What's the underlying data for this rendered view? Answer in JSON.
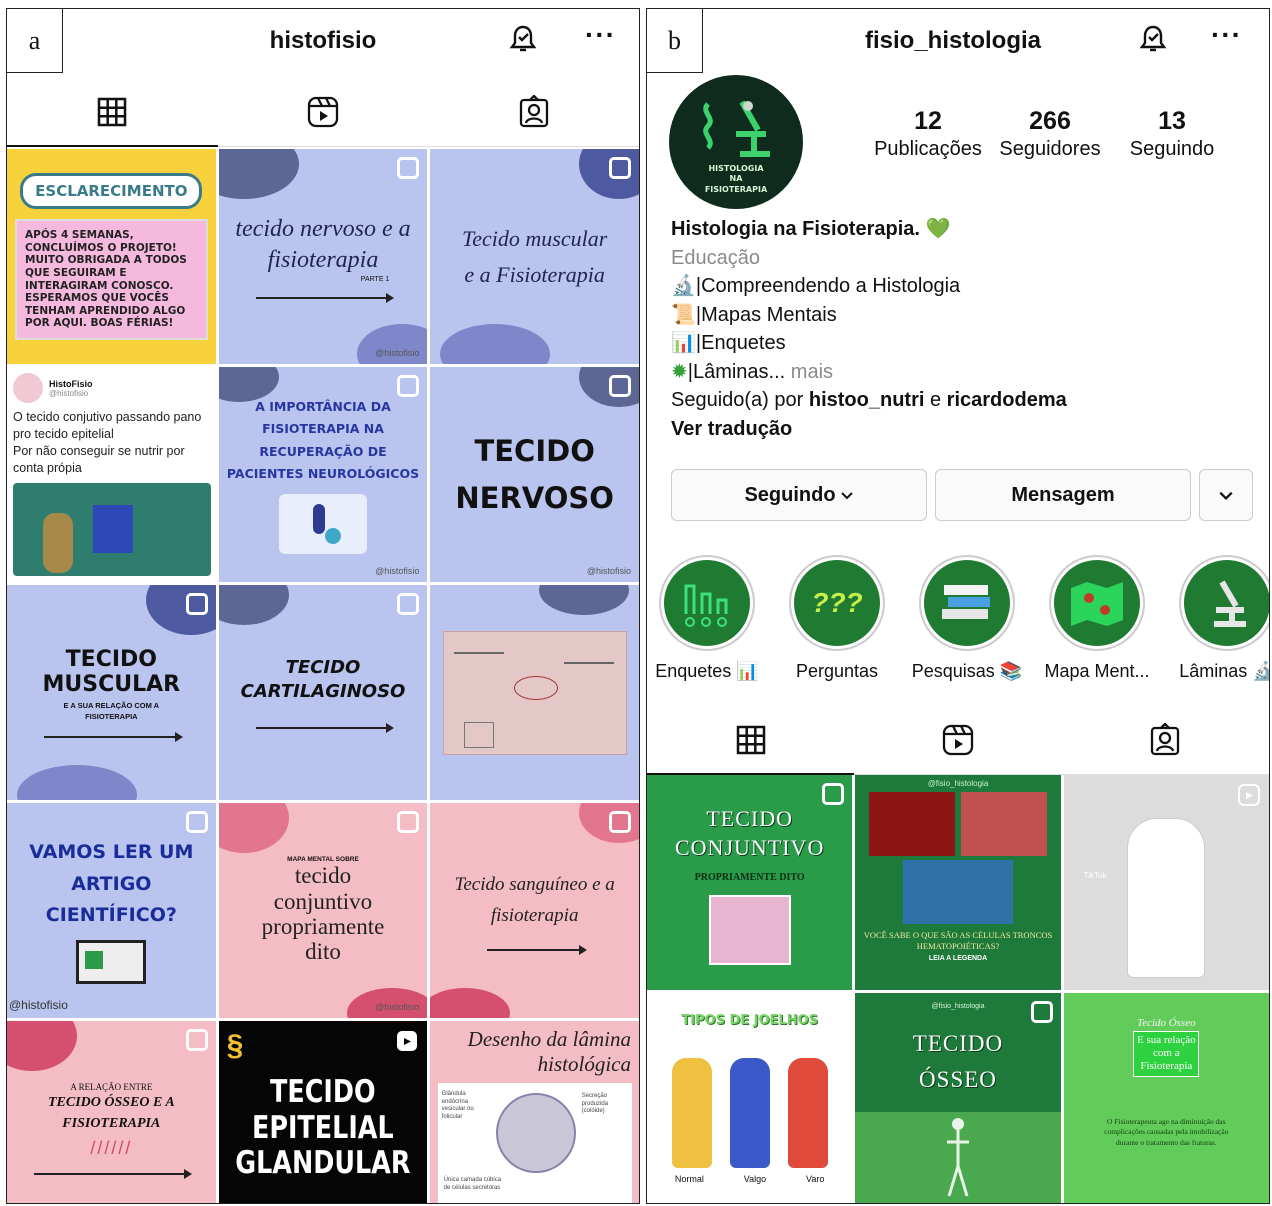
{
  "panel_a": {
    "letter": "a",
    "username": "histofisio",
    "more": "···",
    "icons": {
      "bell": "bell-check-icon",
      "grid": "grid-icon",
      "reels": "reels-icon",
      "tagged": "tagged-icon"
    },
    "posts": {
      "p1": {
        "title": "ESCLARECIMENTO",
        "body": "APÓS 4 SEMANAS, CONCLUÍMOS O PROJETO! MUITO OBRIGADA A TODOS QUE SEGUIRAM E INTERAGIRAM CONOSCO. ESPERAMOS QUE VOCÊS TENHAM APRENDIDO ALGO POR AQUI. BOAS FÉRIAS!"
      },
      "p2": {
        "title": "tecido nervoso e a fisioterapia",
        "small": "PARTE 1",
        "wm": "@histofisio"
      },
      "p3": {
        "title": "Tecido muscular e a Fisioterapia"
      },
      "p4": {
        "name": "HistoFisio",
        "handle": "@histofisio",
        "text": "O tecido conjutivo passando pano pro tecido epitelial\nPor não conseguir se nutrir por conta própia"
      },
      "p5": {
        "title": "A IMPORTÂNCIA DA FISIOTERAPIA NA RECUPERAÇÃO DE PACIENTES NEUROLÓGICOS",
        "wm": "@histofisio"
      },
      "p6": {
        "title": "TECIDO NERVOSO",
        "wm": "@histofisio"
      },
      "p7": {
        "title": "TECIDO MUSCULAR",
        "sub": "E A SUA RELAÇÃO COM A FISIOTERAPIA"
      },
      "p8": {
        "title": "TECIDO CARTILAGINOSO"
      },
      "p10": {
        "title": "VAMOS LER UM ARTIGO CIENTÍFICO?",
        "wm": "@histofisio"
      },
      "p11": {
        "title": "tecido conjuntivo propriamente dito",
        "small": "MAPA MENTAL SOBRE",
        "wm": "@histofisio"
      },
      "p12": {
        "title": "Tecido sanguíneo e a fisioterapia"
      },
      "p13": {
        "small": "A RELAÇÃO ENTRE",
        "title": "TECIDO ÓSSEO E A FISIOTERAPIA",
        "marks": "//////"
      },
      "p14": {
        "title": "TECIDO EPITELIAL GLANDULAR"
      },
      "p15": {
        "title": "Desenho da lâmina histológica",
        "l1": "Glândula endócrina vesicular ou folicular",
        "l2": "Secreção produzida (colóide)",
        "l3": "Única camada cúbica de células secretoras"
      }
    }
  },
  "panel_b": {
    "letter": "b",
    "username": "fisio_histologia",
    "more": "···",
    "avatar_text": "HISTOLOGIA\nNA\nFISIOTERAPIA",
    "stats": [
      {
        "num": "12",
        "label": "Publicações"
      },
      {
        "num": "266",
        "label": "Seguidores"
      },
      {
        "num": "13",
        "label": "Seguindo"
      }
    ],
    "bio": {
      "name": "Histologia na Fisioterapia.",
      "category": "Educação",
      "l1": "|Compreendendo a Histologia",
      "l2": "|Mapas Mentais",
      "l3": "|Enquetes",
      "l4": "|Lâminas...",
      "more": "mais",
      "followed_prefix": "Seguido(a) por",
      "follower1": "histoo_nutri",
      "and": "e",
      "follower2": "ricardodema",
      "translate": "Ver tradução"
    },
    "buttons": {
      "following": "Seguindo",
      "message": "Mensagem"
    },
    "highlights": [
      {
        "label": "Enquetes"
      },
      {
        "label": "Perguntas"
      },
      {
        "label": "Pesquisas"
      },
      {
        "label": "Mapa Ment..."
      },
      {
        "label": "Lâminas"
      }
    ],
    "posts": {
      "q1": {
        "title": "TECIDO CONJUNTIVO",
        "sub": "PROPRIAMENTE DITO"
      },
      "q2": {
        "top": "@fisio_histologia",
        "text": "VOCÊ SABE O QUE SÃO AS CÉLULAS TRONCOS HEMATOPOIÉTICAS?",
        "cta": "LEIA A LEGENDA"
      },
      "q3": {
        "tag": "TikTok"
      },
      "q4": {
        "title": "TIPOS DE JOELHOS",
        "a": "Normal",
        "b": "Valgo",
        "c": "Varo"
      },
      "q5": {
        "top": "@fisio_histologia",
        "title": "TECIDO ÓSSEO"
      },
      "q6": {
        "title": "Tecido Ósseo",
        "hl": "E sua relação com a Fisioterapia",
        "body": "O Fisioterapeuta age na diminuição das complicações causadas pela imobilização durante o tratamento das fraturas."
      }
    }
  },
  "colors": {
    "lavender": "#b9c5ee",
    "pink": "#f4bcc4",
    "green": "#2a9b49"
  }
}
